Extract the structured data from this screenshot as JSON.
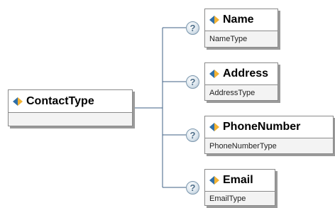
{
  "root": {
    "title": "ContactType",
    "icon": "element-icon"
  },
  "children": [
    {
      "title": "Name",
      "type": "NameType",
      "badge": "?",
      "icon": "element-icon"
    },
    {
      "title": "Address",
      "type": "AddressType",
      "badge": "?",
      "icon": "element-icon"
    },
    {
      "title": "PhoneNumber",
      "type": "PhoneNumberType",
      "badge": "?",
      "icon": "element-icon"
    },
    {
      "title": "Email",
      "type": "EmailType",
      "badge": "?",
      "icon": "element-icon"
    }
  ]
}
